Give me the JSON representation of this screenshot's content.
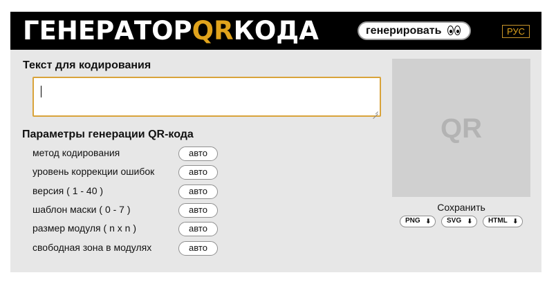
{
  "header": {
    "logo_part1": "ГЕНЕРАТОР",
    "logo_part2": "QR",
    "logo_part3": "КОДА",
    "generate_label": "генерировать",
    "language": "РУС",
    "brand_color": "#000000",
    "accent_color": "#e0a31c"
  },
  "input": {
    "title": "Текст для кодирования",
    "value": ""
  },
  "params": {
    "title": "Параметры генерации QR-кода",
    "rows": [
      {
        "label": "метод кодирования",
        "value": "авто"
      },
      {
        "label": "уровень коррекции ошибок",
        "value": "авто"
      },
      {
        "label": "версия ( 1 - 40 )",
        "value": "авто"
      },
      {
        "label": "шаблон маски ( 0 - 7 )",
        "value": "авто"
      },
      {
        "label": "размер модуля ( n x n )",
        "value": "авто"
      },
      {
        "label": "свободная зона в модулях",
        "value": "авто"
      }
    ]
  },
  "preview": {
    "placeholder": "QR",
    "save_label": "Сохранить",
    "formats": [
      {
        "label": "PNG",
        "icon": "download-arrow-icon"
      },
      {
        "label": "SVG",
        "icon": "download-arrow-icon"
      },
      {
        "label": "HTML",
        "icon": "download-arrow-icon"
      }
    ]
  }
}
